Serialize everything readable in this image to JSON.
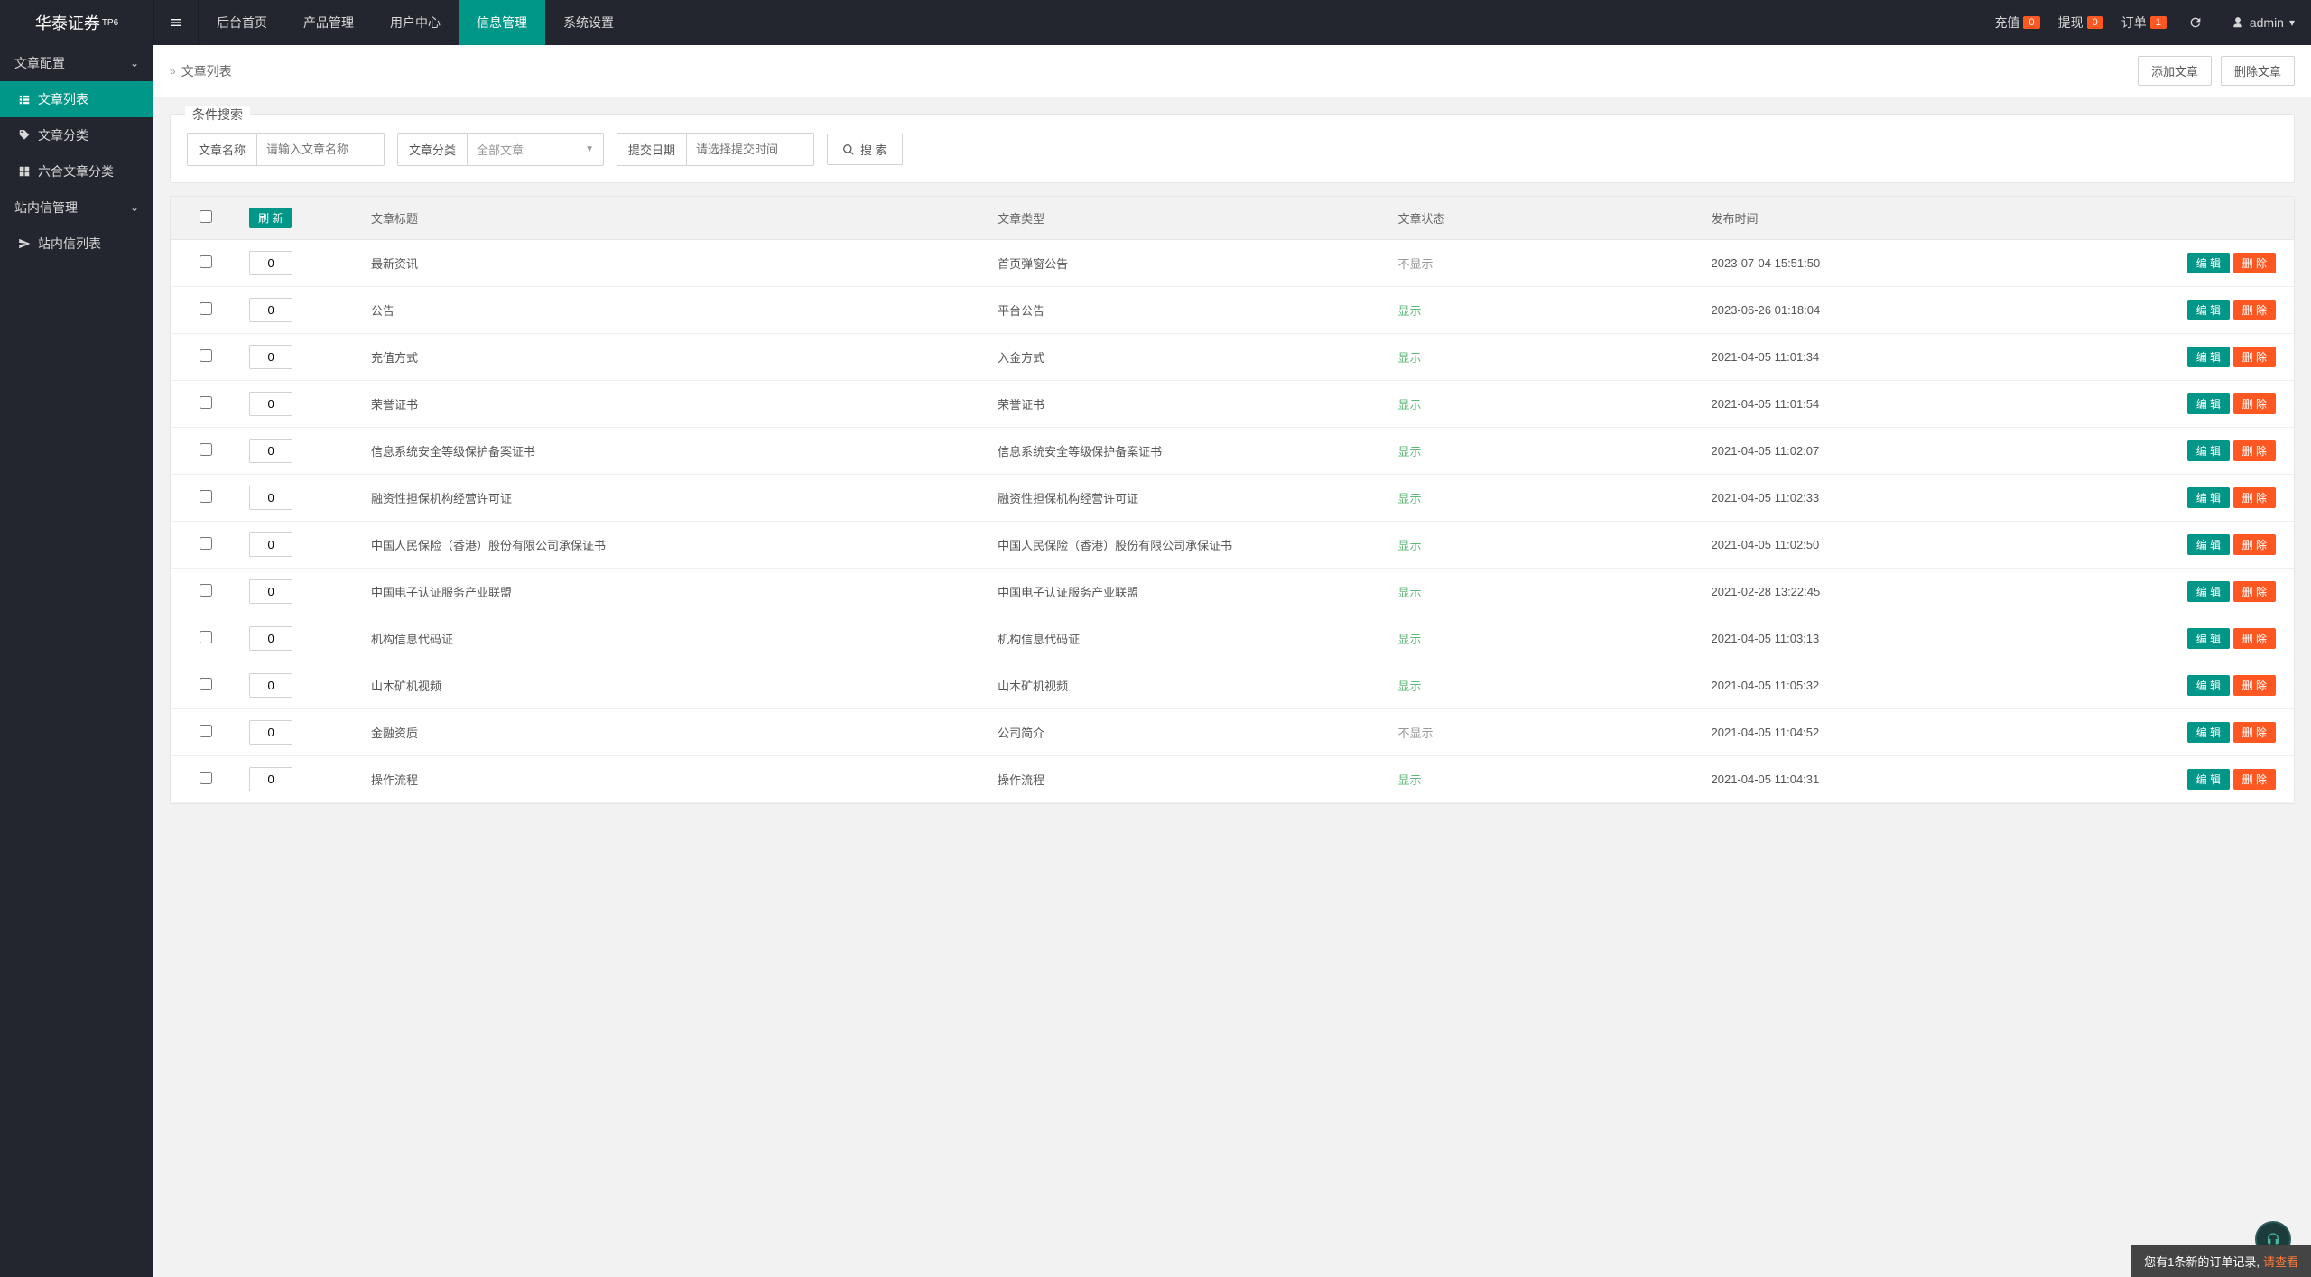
{
  "brand": {
    "name": "华泰证券",
    "sup": "TP6"
  },
  "topnav": [
    {
      "label": "后台首页"
    },
    {
      "label": "产品管理"
    },
    {
      "label": "用户中心"
    },
    {
      "label": "信息管理",
      "active": true
    },
    {
      "label": "系统设置"
    }
  ],
  "topbar_right": {
    "recharge": {
      "label": "充值",
      "count": "0"
    },
    "withdraw": {
      "label": "提现",
      "count": "0"
    },
    "orders": {
      "label": "订单",
      "count": "1"
    },
    "user": "admin"
  },
  "sidebar": {
    "group1_label": "文章配置",
    "item_list": "文章列表",
    "item_category": "文章分类",
    "item_liuhe": "六合文章分类",
    "group2_label": "站内信管理",
    "item_msg_list": "站内信列表"
  },
  "breadcrumb": {
    "title": "文章列表"
  },
  "actions": {
    "add": "添加文章",
    "delete": "删除文章"
  },
  "search": {
    "legend": "条件搜索",
    "name_label": "文章名称",
    "name_placeholder": "请输入文章名称",
    "cat_label": "文章分类",
    "cat_value": "全部文章",
    "date_label": "提交日期",
    "date_placeholder": "请选择提交时间",
    "search_btn": "搜 索"
  },
  "table": {
    "refresh_btn": "刷 新",
    "headers": {
      "title": "文章标题",
      "type": "文章类型",
      "status": "文章状态",
      "time": "发布时间"
    },
    "edit": "编 辑",
    "delete": "删 除",
    "status_show": "显示",
    "status_hide": "不显示",
    "rows": [
      {
        "sort": "0",
        "title": "最新资讯",
        "type": "首页弹窗公告",
        "status": "hide",
        "time": "2023-07-04 15:51:50"
      },
      {
        "sort": "0",
        "title": "公告",
        "type": "平台公告",
        "status": "show",
        "time": "2023-06-26 01:18:04"
      },
      {
        "sort": "0",
        "title": "充值方式",
        "type": "入金方式",
        "status": "show",
        "time": "2021-04-05 11:01:34"
      },
      {
        "sort": "0",
        "title": "荣誉证书",
        "type": "荣誉证书",
        "status": "show",
        "time": "2021-04-05 11:01:54"
      },
      {
        "sort": "0",
        "title": "信息系统安全等级保护备案证书",
        "type": "信息系统安全等级保护备案证书",
        "status": "show",
        "time": "2021-04-05 11:02:07"
      },
      {
        "sort": "0",
        "title": "融资性担保机构经营许可证",
        "type": "融资性担保机构经营许可证",
        "status": "show",
        "time": "2021-04-05 11:02:33"
      },
      {
        "sort": "0",
        "title": "中国人民保险（香港）股份有限公司承保证书",
        "type": "中国人民保险（香港）股份有限公司承保证书",
        "status": "show",
        "time": "2021-04-05 11:02:50"
      },
      {
        "sort": "0",
        "title": "中国电子认证服务产业联盟",
        "type": "中国电子认证服务产业联盟",
        "status": "show",
        "time": "2021-02-28 13:22:45"
      },
      {
        "sort": "0",
        "title": "机构信息代码证",
        "type": "机构信息代码证",
        "status": "show",
        "time": "2021-04-05 11:03:13"
      },
      {
        "sort": "0",
        "title": "山木矿机视频",
        "type": "山木矿机视频",
        "status": "show",
        "time": "2021-04-05 11:05:32"
      },
      {
        "sort": "0",
        "title": "金融资质",
        "type": "公司简介",
        "status": "hide",
        "time": "2021-04-05 11:04:52"
      },
      {
        "sort": "0",
        "title": "操作流程",
        "type": "操作流程",
        "status": "show",
        "time": "2021-04-05 11:04:31"
      }
    ]
  },
  "notif": {
    "text": "您有1条新的订单记录,",
    "link": "请查看"
  }
}
